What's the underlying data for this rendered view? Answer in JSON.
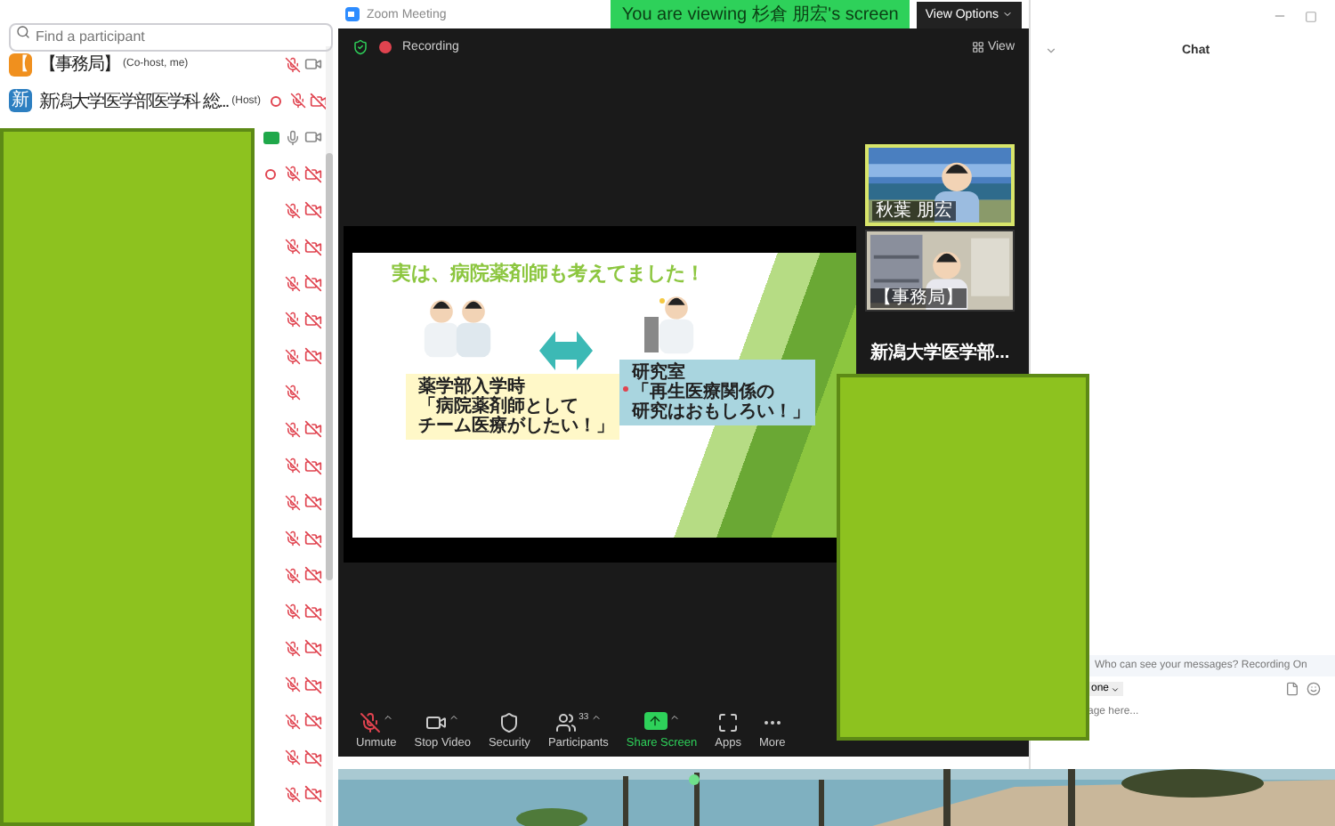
{
  "participants_panel": {
    "search": {
      "placeholder": "Find a participant"
    },
    "participants": [
      {
        "avatar": "【",
        "color": "#f0901e",
        "name": "【事務局】",
        "role": "(Co-host, me)",
        "recording": false,
        "badge": false,
        "muted": true,
        "camera": true,
        "video_off": false
      },
      {
        "avatar": "新",
        "color": "#2d7fc1",
        "name": "新潟大学医学部医学科 総...",
        "role": "(Host)",
        "recording": true,
        "badge": false,
        "muted": true,
        "camera": true,
        "video_off": true
      },
      {
        "recording": false,
        "badge": true,
        "muted": false,
        "camera": true,
        "video_off": false
      },
      {
        "recording": true,
        "badge": false,
        "muted": true,
        "camera": true,
        "video_off": true
      },
      {
        "recording": false,
        "badge": false,
        "muted": true,
        "camera": true,
        "video_off": true
      },
      {
        "recording": false,
        "badge": false,
        "muted": true,
        "camera": true,
        "video_off": true
      },
      {
        "recording": false,
        "badge": false,
        "muted": true,
        "camera": true,
        "video_off": true
      },
      {
        "recording": false,
        "badge": false,
        "muted": true,
        "camera": true,
        "video_off": true
      },
      {
        "recording": false,
        "badge": false,
        "muted": true,
        "camera": true,
        "video_off": true
      },
      {
        "recording": false,
        "badge": false,
        "muted": true,
        "camera": false
      },
      {
        "recording": false,
        "badge": false,
        "muted": true,
        "camera": true,
        "video_off": true
      },
      {
        "recording": false,
        "badge": false,
        "muted": true,
        "camera": true,
        "video_off": true
      },
      {
        "recording": false,
        "badge": false,
        "muted": true,
        "camera": true,
        "video_off": true
      },
      {
        "recording": false,
        "badge": false,
        "muted": true,
        "camera": true,
        "video_off": true
      },
      {
        "recording": false,
        "badge": false,
        "muted": true,
        "camera": true,
        "video_off": true
      },
      {
        "recording": false,
        "badge": false,
        "muted": true,
        "camera": true,
        "video_off": true
      },
      {
        "recording": false,
        "badge": false,
        "muted": true,
        "camera": true,
        "video_off": true
      },
      {
        "recording": false,
        "badge": false,
        "muted": true,
        "camera": true,
        "video_off": true
      },
      {
        "recording": false,
        "badge": false,
        "muted": true,
        "camera": true,
        "video_off": true
      },
      {
        "recording": false,
        "badge": false,
        "muted": true,
        "camera": true,
        "video_off": true
      },
      {
        "recording": false,
        "badge": false,
        "muted": true,
        "camera": true,
        "video_off": true
      }
    ]
  },
  "meeting": {
    "title": "Zoom Meeting",
    "banner": "You are viewing 杉倉 朋宏's screen",
    "view_options": "View Options",
    "recording_label": "Recording",
    "view_button": "View",
    "slide": {
      "title": "実は、病院薬剤師も考えてました！",
      "captions": [
        {
          "lines": [
            "薬学部入学時",
            "「病院薬剤師として",
            "チーム医療がしたい！」"
          ],
          "bullet": false
        },
        {
          "lines": [
            "研究室",
            "「再生医療関係の",
            "研究はおもしろい！」"
          ],
          "bullet": true
        }
      ]
    },
    "videos": [
      {
        "name": "秋葉 朋宏",
        "kind": "outdoor",
        "selected": true
      },
      {
        "name": "【事務局】",
        "kind": "office",
        "selected": false
      }
    ],
    "more_participants": "新潟大学医学部...",
    "toolbar": [
      {
        "label": "Unmute",
        "kind": "mic",
        "menu": true,
        "highlight": false
      },
      {
        "label": "Stop Video",
        "kind": "video",
        "menu": true,
        "highlight": false
      },
      {
        "label": "Security",
        "kind": "security",
        "menu": false,
        "highlight": false
      },
      {
        "label": "Participants",
        "kind": "participants",
        "count": "33",
        "menu": true,
        "highlight": false
      },
      {
        "label": "Share Screen",
        "kind": "share",
        "menu": true,
        "highlight": true
      },
      {
        "label": "Apps",
        "kind": "apps",
        "menu": false,
        "highlight": false
      },
      {
        "label": "More",
        "kind": "more",
        "menu": false,
        "highlight": false
      }
    ]
  },
  "chat": {
    "title": "Chat",
    "notice": "Who can see your messages? Recording On",
    "recipient": "one",
    "input": {
      "placeholder": "age here..."
    }
  }
}
